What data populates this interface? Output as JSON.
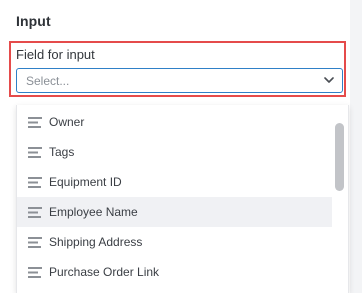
{
  "section": {
    "title": "Input"
  },
  "field": {
    "label": "Field for input",
    "placeholder": "Select...",
    "chevron_icon": "chevron-down-icon"
  },
  "dropdown": {
    "item_icon": "text-lines-icon",
    "hovered_index": 3,
    "options": [
      {
        "label": "Owner"
      },
      {
        "label": "Tags"
      },
      {
        "label": "Equipment ID"
      },
      {
        "label": "Employee Name"
      },
      {
        "label": "Shipping Address"
      },
      {
        "label": "Purchase Order Link"
      }
    ]
  },
  "colors": {
    "highlight_border": "#e54b4b",
    "focus_border": "#2f80c7",
    "hover_background": "#f0f1f4",
    "icon": "#8c9096"
  }
}
